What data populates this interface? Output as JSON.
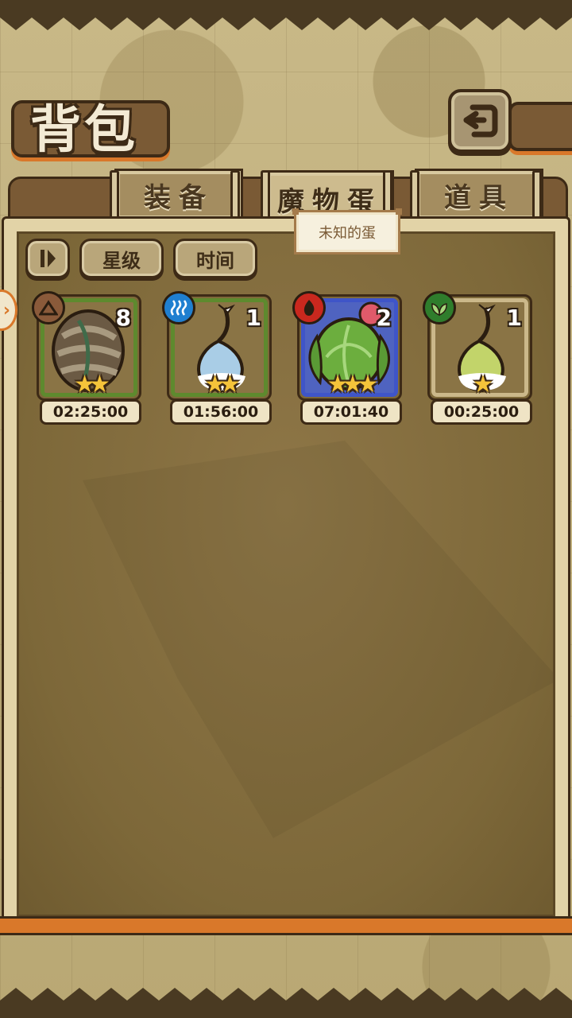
{
  "header": {
    "title": "背包"
  },
  "tabs": [
    {
      "label": "装备",
      "active": false
    },
    {
      "label": "魔物蛋",
      "active": true
    },
    {
      "label": "道具",
      "active": false
    }
  ],
  "tooltip": {
    "text": "未知的蛋"
  },
  "sort": {
    "toggle_icon": "sort-toggle-icon",
    "buttons": [
      {
        "label": "星级"
      },
      {
        "label": "时间"
      }
    ]
  },
  "eggs": [
    {
      "element": "earth",
      "element_color": "#8a5a3a",
      "frame_color": "#5e8a2e",
      "count": "8",
      "stars": 2,
      "stars_text": "★★",
      "timer": "02:25:00"
    },
    {
      "element": "water",
      "element_color": "#1f7fd0",
      "frame_color": "#5e8a2e",
      "count": "1",
      "stars": 2,
      "stars_text": "★★",
      "timer": "01:56:00"
    },
    {
      "element": "fire",
      "element_color": "#c9281e",
      "frame_color": "#3f55c8",
      "count": "2",
      "stars": 3,
      "stars_text": "★★★",
      "timer": "07:01:40"
    },
    {
      "element": "grass",
      "element_color": "#2f7d2c",
      "frame_color": "#cbb88a",
      "count": "1",
      "stars": 1,
      "stars_text": "★",
      "timer": "00:25:00"
    }
  ]
}
